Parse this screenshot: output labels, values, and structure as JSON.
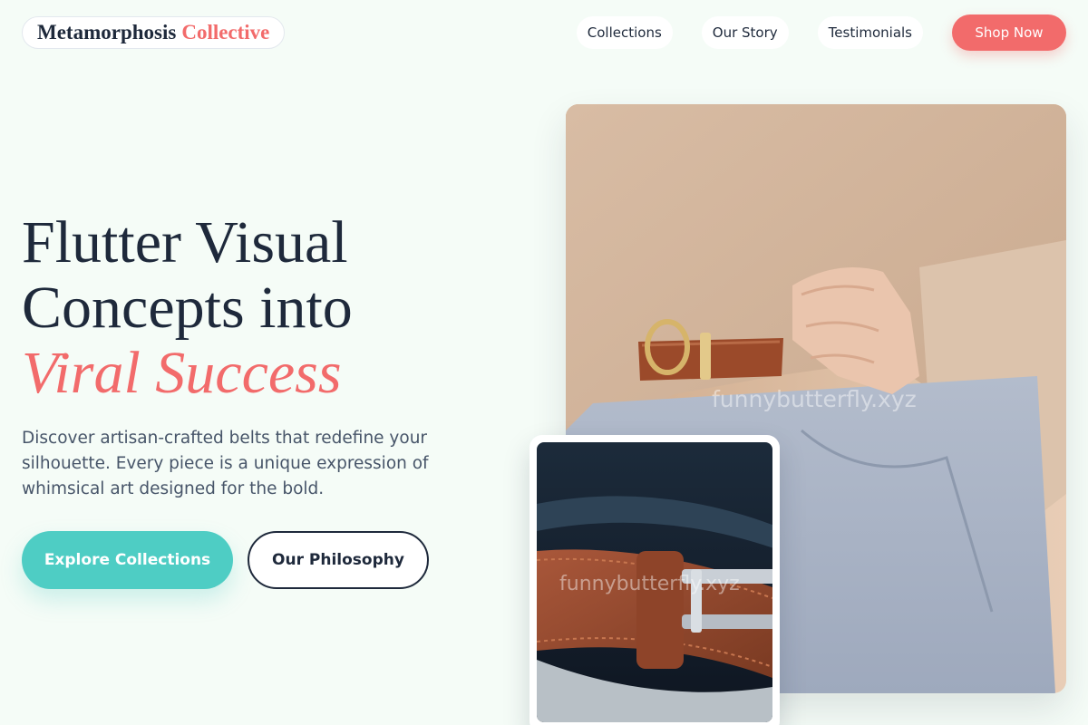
{
  "header": {
    "logo_primary": "Metamorphosis",
    "logo_accent": "Collective",
    "nav": [
      {
        "label": "Collections"
      },
      {
        "label": "Our Story"
      },
      {
        "label": "Testimonials"
      }
    ],
    "cta_label": "Shop Now"
  },
  "hero": {
    "title_line1": "Flutter Visual",
    "title_line2": "Concepts into",
    "title_highlight": "Viral Success",
    "description": "Discover artisan-crafted belts that redefine your silhouette. Every piece is a unique expression of whimsical art designed for the bold.",
    "primary_button": "Explore Collections",
    "secondary_button": "Our Philosophy"
  },
  "images": {
    "main": {
      "icon": "photo-belt-model",
      "watermark": "funnybutterfly.xyz"
    },
    "secondary": {
      "icon": "photo-belt-closeup",
      "watermark": "funnybutterfly.xyz"
    }
  },
  "colors": {
    "background": "#f5fcf7",
    "text": "#1e293b",
    "accent": "#f26b6b",
    "teal": "#4ecdc4"
  }
}
